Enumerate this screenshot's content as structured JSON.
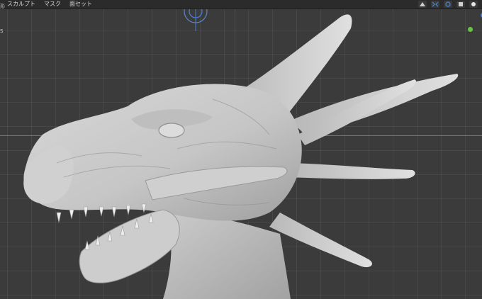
{
  "menu": {
    "sculpt": "スカルプト",
    "mask": "マスク",
    "face_sets": "面セット"
  },
  "left_labels": {
    "top": "形",
    "mid": "S"
  },
  "icons": {
    "gizmo": "transform-gizmo-icon",
    "brush_dyntopo": "dyntopo-icon",
    "symmetry": "symmetry-icon",
    "overlays": "overlays-icon",
    "shading_solid": "shading-solid-icon",
    "shading_material": "shading-material-icon"
  },
  "colors": {
    "viewport_bg": "#3b3b3b",
    "axis_x": "#6f8f3a",
    "axis_z": "#4f6f9a",
    "mesh": "#c9c9c9",
    "mesh_shadow": "#8a8a8a"
  }
}
